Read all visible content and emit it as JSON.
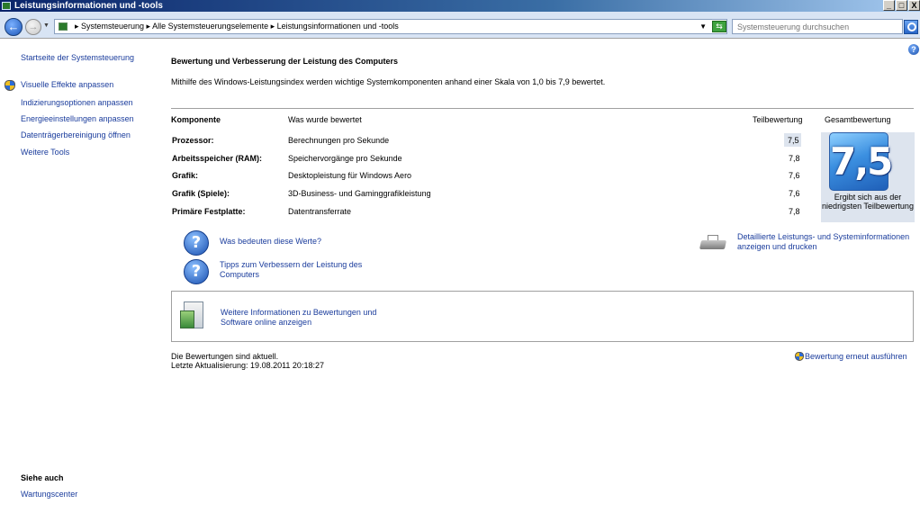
{
  "window": {
    "title": "Leistungsinformationen und -tools",
    "minimize": "_",
    "maximize": "□",
    "close": "X"
  },
  "addressbar": {
    "crumbs": "▸ Systemsteuerung ▸ Alle Systemsteuerungselemente ▸ Leistungsinformationen und -tools",
    "search_placeholder": "Systemsteuerung durchsuchen"
  },
  "sidebar": {
    "home": "Startseite der Systemsteuerung",
    "items": [
      "Visuelle Effekte anpassen",
      "Indizierungsoptionen anpassen",
      "Energieeinstellungen anpassen",
      "Datenträgerbereinigung öffnen",
      "Weitere Tools"
    ],
    "see_also_title": "Siehe auch",
    "see_also_items": [
      "Wartungscenter"
    ]
  },
  "main": {
    "title": "Bewertung und Verbesserung der Leistung des Computers",
    "description": "Mithilfe des Windows-Leistungsindex werden wichtige Systemkomponenten anhand einer Skala von 1,0 bis 7,9 bewertet.",
    "headers": {
      "component": "Komponente",
      "rated": "Was wurde bewertet",
      "subscore": "Teilbewertung",
      "basescore": "Gesamtbewertung"
    },
    "rows": [
      {
        "component": "Prozessor:",
        "rated": "Berechnungen pro Sekunde",
        "subscore": "7,5"
      },
      {
        "component": "Arbeitsspeicher (RAM):",
        "rated": "Speichervorgänge pro Sekunde",
        "subscore": "7,8"
      },
      {
        "component": "Grafik:",
        "rated": "Desktopleistung für Windows Aero",
        "subscore": "7,6"
      },
      {
        "component": "Grafik (Spiele):",
        "rated": "3D-Business- und Gaminggrafikleistung",
        "subscore": "7,6"
      },
      {
        "component": "Primäre Festplatte:",
        "rated": "Datentransferrate",
        "subscore": "7,8"
      }
    ],
    "base_score": "7,5",
    "base_score_note": "Ergibt sich aus der niedrigsten Teilbewertung",
    "links": {
      "what_mean": "Was bedeuten diese Werte?",
      "tips": "Tipps zum Verbessern der Leistung des Computers",
      "details": "Detaillierte Leistungs- und Systeminformationen anzeigen und drucken",
      "online": "Weitere Informationen zu Bewertungen und Software online anzeigen"
    },
    "status_current": "Die Bewertungen sind aktuell.",
    "status_updated": "Letzte Aktualisierung: 19.08.2011 20:18:27",
    "rerun": "Bewertung erneut ausführen"
  }
}
